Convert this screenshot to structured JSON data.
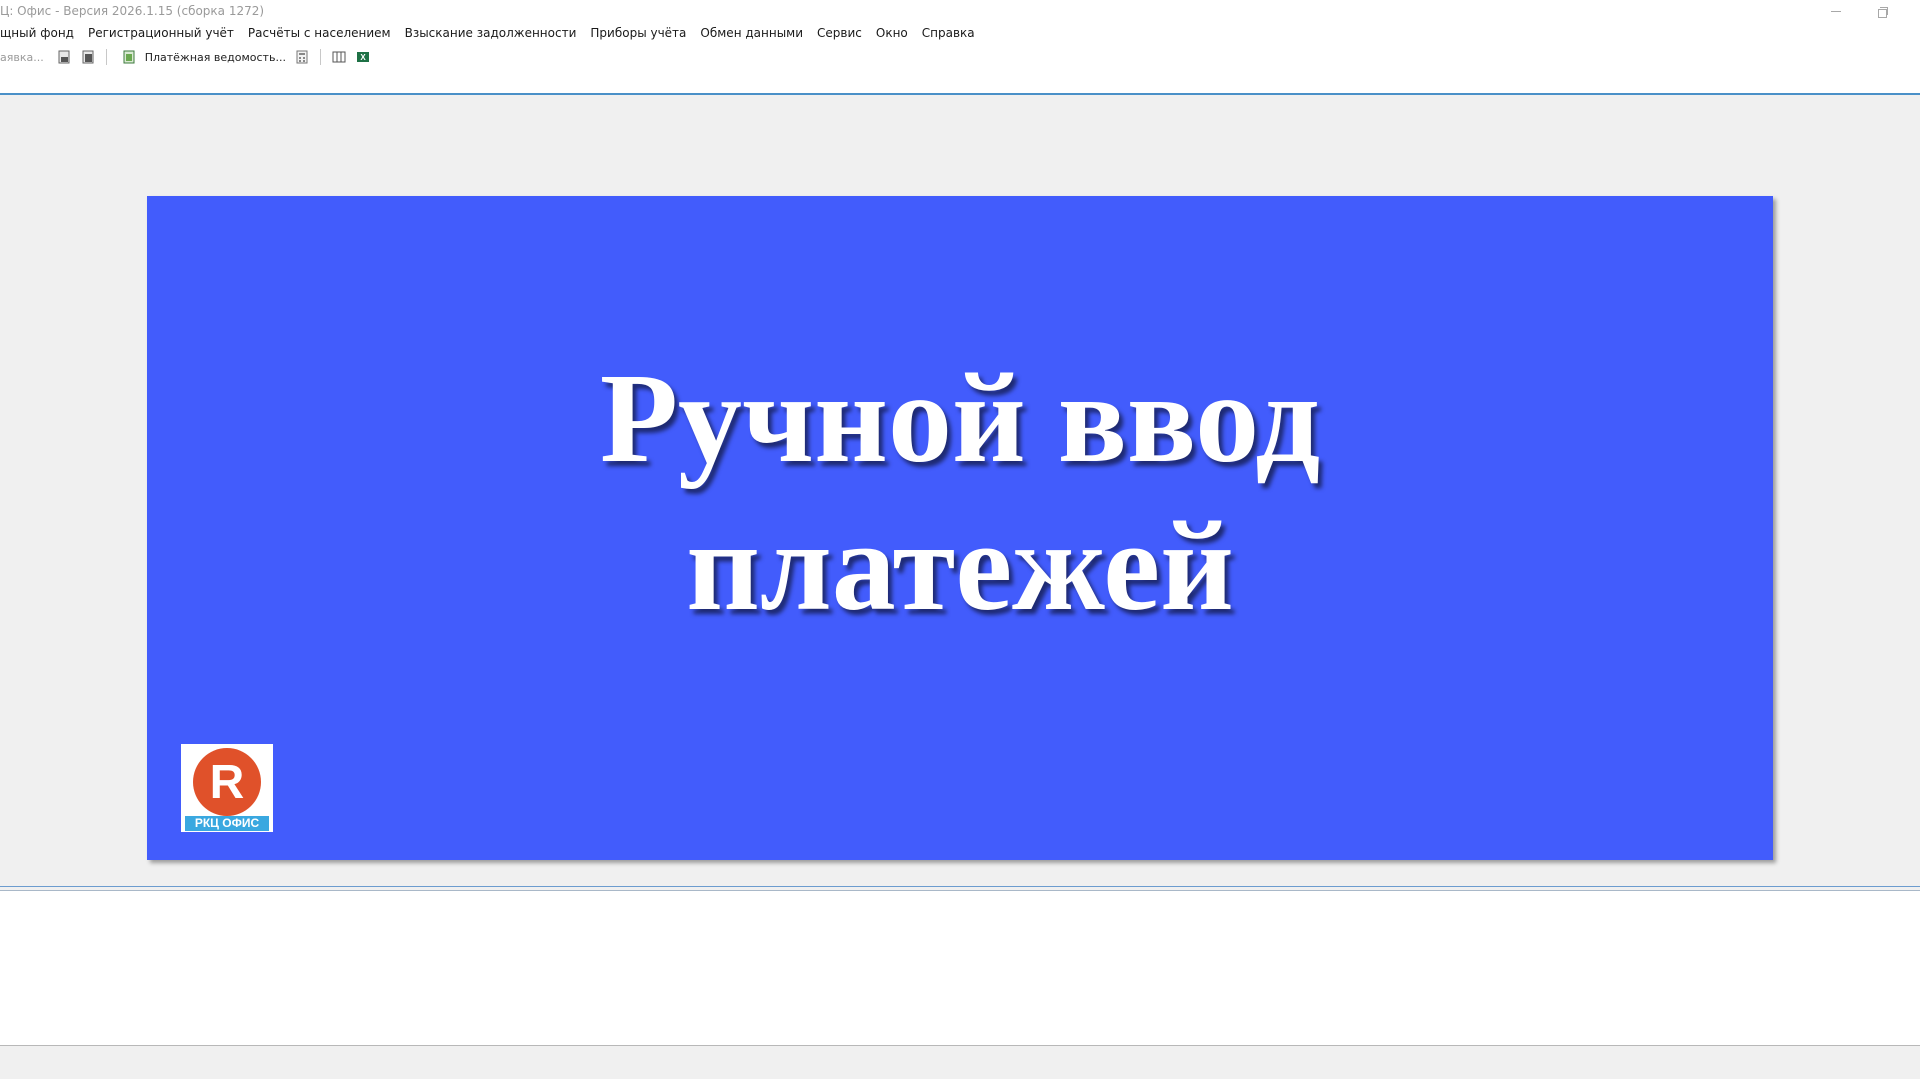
{
  "window": {
    "title": "Ц: Офис - Версия 2026.1.15 (сборка 1272)"
  },
  "menu": {
    "items": [
      "щный фонд",
      "Регистрационный учёт",
      "Расчёты с населением",
      "Взыскание задолженности",
      "Приборы учёта",
      "Обмен данными",
      "Сервис",
      "Окно",
      "Справка"
    ]
  },
  "toolbar": {
    "truncated_label": "аявка...",
    "payment_sheet_label": "Платёжная ведомость..."
  },
  "banner": {
    "line1": "Ручной ввод",
    "line2": "платежей",
    "background_color": "#425cfc"
  },
  "logo": {
    "letter": "R",
    "text": "РКЦ ОФИС",
    "circle_color": "#e0512a",
    "text_bg_color": "#3aa8e0"
  },
  "icons": {
    "window_controls": [
      "minimize-icon",
      "restore-icon"
    ],
    "toolbar": [
      "document-icon",
      "document-icon-2",
      "spreadsheet-icon",
      "calculator-icon",
      "columns-icon",
      "excel-export-icon"
    ]
  }
}
